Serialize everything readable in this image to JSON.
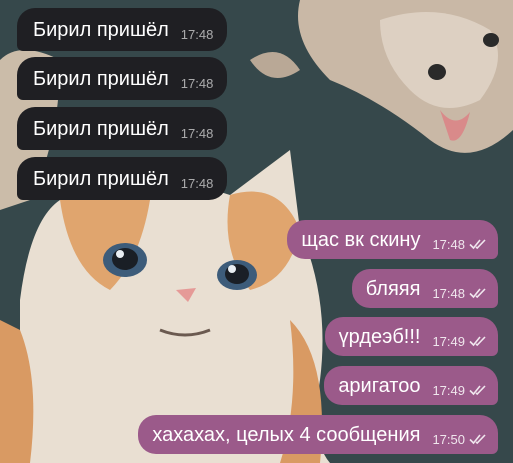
{
  "colors": {
    "incoming_bubble": "#1f1f23",
    "outgoing_bubble": "#9b5a8a",
    "text": "#ffffff"
  },
  "icons": {
    "read_receipt": "double-check-icon"
  },
  "incoming": [
    {
      "text": "Бирил пришёл",
      "time": "17:48"
    },
    {
      "text": "Бирил пришёл",
      "time": "17:48"
    },
    {
      "text": "Бирил пришёл",
      "time": "17:48"
    },
    {
      "text": "Бирил пришёл",
      "time": "17:48"
    }
  ],
  "outgoing": [
    {
      "text": "щас вк скину",
      "time": "17:48"
    },
    {
      "text": "бляяя",
      "time": "17:48"
    },
    {
      "text": "үрдеэб!!!",
      "time": "17:49"
    },
    {
      "text": "аригатоо",
      "time": "17:49"
    },
    {
      "text": "хахахах, целых 4 сообщения",
      "time": "17:50"
    }
  ]
}
